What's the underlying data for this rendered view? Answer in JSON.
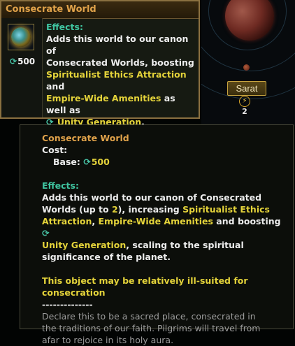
{
  "tooltip_main": {
    "title": "Consecrate World",
    "cost": "500",
    "effects_label": "Effects:",
    "line1": "Adds this world to our canon of",
    "line2": "Consecrated Worlds, boosting",
    "hl1": "Spiritualist Ethics Attraction",
    "and": " and",
    "hl2": "Empire-Wide Amenities",
    "as_well_as": " as well as",
    "hl3": "Unity Generation",
    "period": "."
  },
  "system": {
    "planet_button": "Sarat",
    "energy_count": "2"
  },
  "tooltip_detail": {
    "title": "Consecrate World",
    "cost_label": "Cost:",
    "base_label": "Base:",
    "base_value": "500",
    "effects_label": "Effects:",
    "p1_a": "Adds this world to our canon of Consecrated",
    "p1_b": "Worlds (up to ",
    "p1_num": "2",
    "p1_c": "), increasing ",
    "p1_hl1": "Spiritualist Ethics",
    "p1_hl1b": "Attraction",
    "p1_d": ", ",
    "p1_hl2": "Empire-Wide Amenities",
    "p1_e": " and boosting ",
    "p1_hl3": "Unity Generation",
    "p1_f": ", scaling to the spiritual",
    "p1_g": "significance of the planet.",
    "warning_1": "This object may be relatively ill-suited for",
    "warning_2": "consecration",
    "separator": "--------------",
    "flavor_1": "Declare this to be a sacred place, consecrated in",
    "flavor_2": "the traditions of our faith. Pilgrims will travel from",
    "flavor_3": "afar to rejoice in its holy aura."
  },
  "colors": {
    "effects_teal": "#3fc4a0",
    "highlight_yellow": "#e4d33a",
    "title_orange": "#e0a24a",
    "flavor_gray": "#9c9c9c"
  },
  "icons": [
    "unity-icon",
    "energy-icon",
    "world-icon"
  ]
}
